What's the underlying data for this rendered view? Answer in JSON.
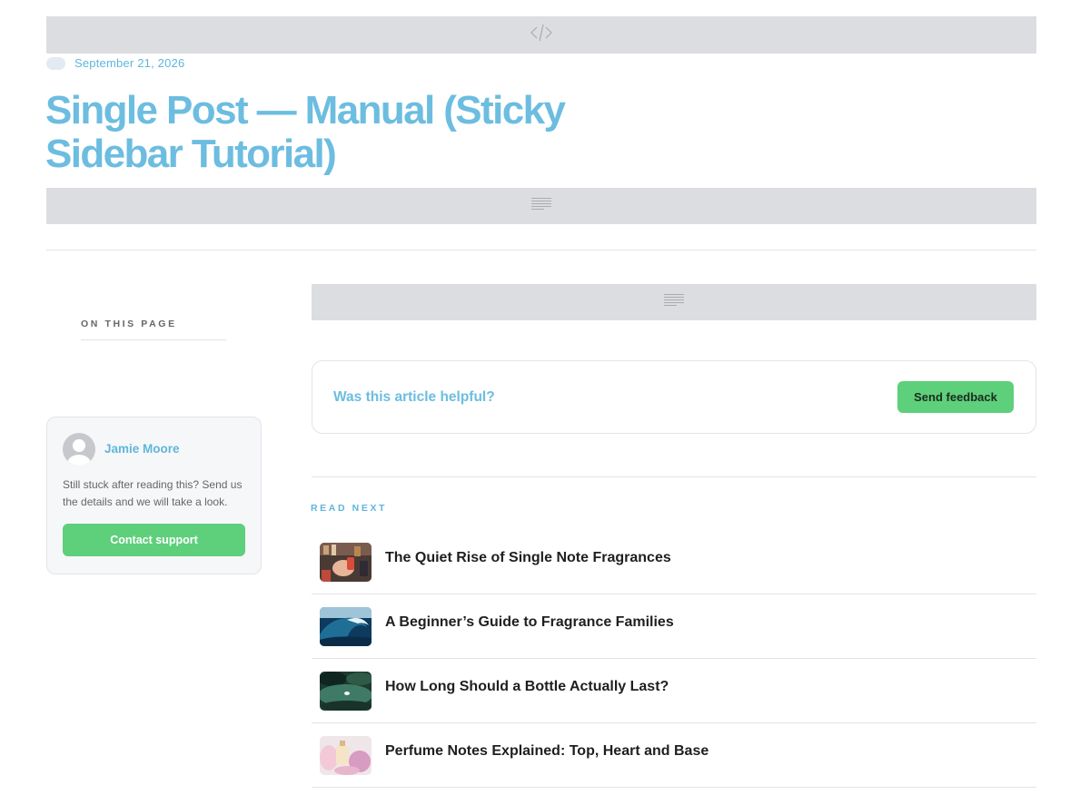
{
  "post": {
    "date": "September 21, 2026",
    "title": "Single Post — Manual (Sticky Sidebar Tutorial)"
  },
  "placeholders": {
    "top_icon": "code-icon",
    "mid_icon": "paragraph-icon",
    "content_icon": "paragraph-icon"
  },
  "toc": {
    "label": "ON THIS PAGE"
  },
  "author": {
    "name": "Jamie Moore",
    "blurb": "Still stuck after reading this? Send us the details and we will take a look.",
    "button": "Contact support"
  },
  "feedback": {
    "question": "Was this article helpful?",
    "button": "Send feedback"
  },
  "read_next": {
    "label": "READ NEXT",
    "items": [
      {
        "title": "The Quiet Rise of Single Note Fragrances",
        "thumb": "perfume-shop-thumbnail"
      },
      {
        "title": "A Beginner’s Guide to Fragrance Families",
        "thumb": "ocean-wave-thumbnail"
      },
      {
        "title": "How Long Should a Bottle Actually Last?",
        "thumb": "lily-pad-pond-thumbnail"
      },
      {
        "title": "Perfume Notes Explained: Top, Heart and Base",
        "thumb": "perfume-bottles-thumbnail"
      }
    ]
  },
  "colors": {
    "accent_blue": "#6cbde0",
    "green_button": "#5ecf7b",
    "placeholder_gray": "#dcdde0"
  }
}
